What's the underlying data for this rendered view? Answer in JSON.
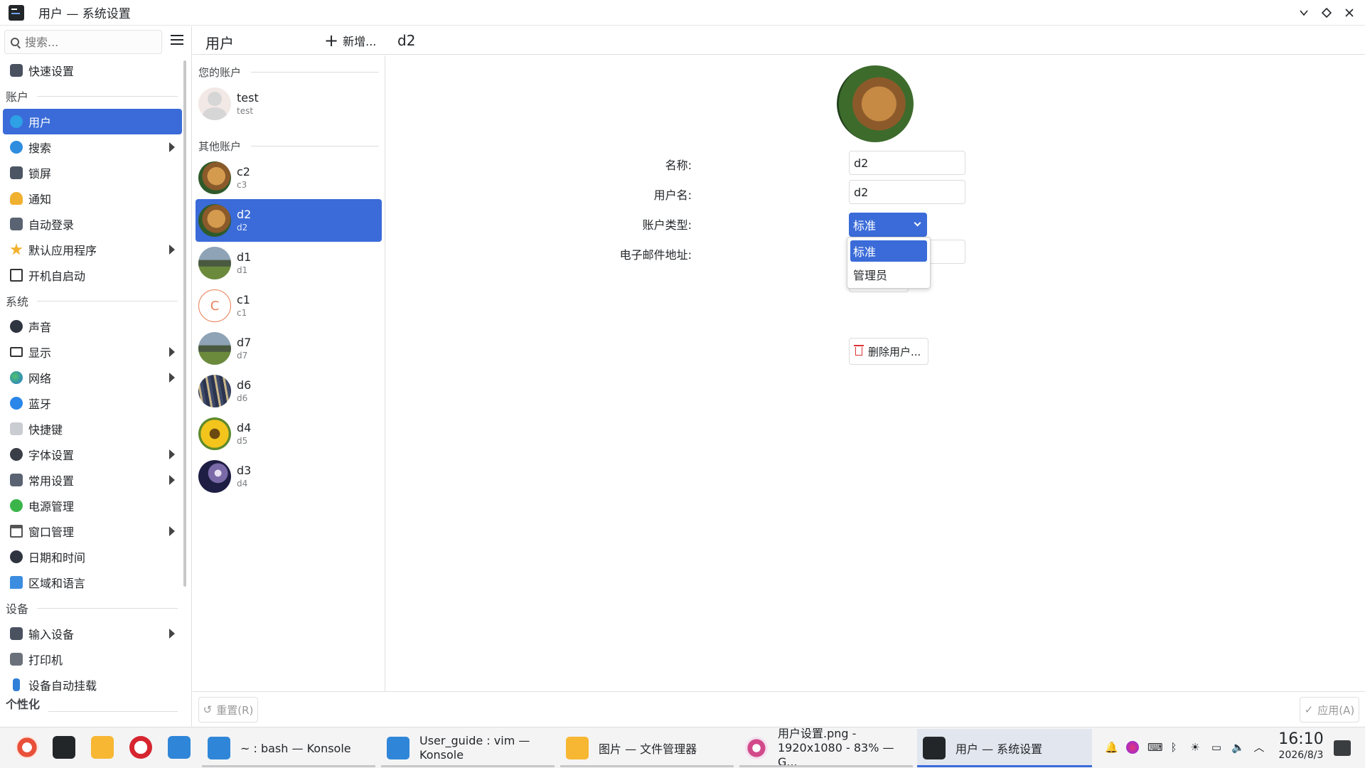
{
  "window": {
    "title": "用户 — 系统设置"
  },
  "search": {
    "placeholder": "搜索..."
  },
  "sidebar": {
    "quick_settings": "快速设置",
    "sections": {
      "accounts": "账户",
      "system": "系统",
      "devices": "设备",
      "personalization": "个性化"
    },
    "items": {
      "users": "用户",
      "search": "搜索",
      "lockscreen": "锁屏",
      "notifications": "通知",
      "autologin": "自动登录",
      "default_apps": "默认应用程序",
      "autostart": "开机自启动",
      "sound": "声音",
      "display": "显示",
      "network": "网络",
      "bluetooth": "蓝牙",
      "shortcuts": "快捷键",
      "fonts": "字体设置",
      "common": "常用设置",
      "power": "电源管理",
      "window_mgmt": "窗口管理",
      "datetime": "日期和时间",
      "region": "区域和语言",
      "input_devices": "输入设备",
      "printers": "打印机",
      "automount": "设备自动挂载"
    }
  },
  "toolbar": {
    "title": "用户",
    "add_label": "新增...",
    "selected_user": "d2"
  },
  "users": {
    "your_account_header": "您的账户",
    "other_accounts_header": "其他账户",
    "current": {
      "name": "test",
      "login": "test"
    },
    "others": [
      {
        "name": "c2",
        "login": "c3"
      },
      {
        "name": "d2",
        "login": "d2"
      },
      {
        "name": "d1",
        "login": "d1"
      },
      {
        "name": "c1",
        "login": "c1",
        "initial": "C"
      },
      {
        "name": "d7",
        "login": "d7"
      },
      {
        "name": "d6",
        "login": "d6"
      },
      {
        "name": "d4",
        "login": "d5"
      },
      {
        "name": "d3",
        "login": "d4"
      }
    ]
  },
  "detail": {
    "name_label": "名称:",
    "name_value": "d2",
    "username_label": "用户名:",
    "username_value": "d2",
    "account_type_label": "账户类型:",
    "account_type_value": "标准",
    "account_type_options": [
      "标准",
      "管理员"
    ],
    "email_label": "电子邮件地址:",
    "delete_label": "删除用户..."
  },
  "bottom": {
    "reset_label": "重置(R)",
    "apply_label": "应用(A)"
  },
  "taskbar": {
    "tasks": [
      {
        "line1": "~ : bash — Konsole",
        "line2": ""
      },
      {
        "line1": "User_guide : vim —",
        "line2": "Konsole"
      },
      {
        "line1": "图片 — 文件管理器",
        "line2": ""
      },
      {
        "line1": "用户设置.png -",
        "line2": "1920x1080 - 83% — G..."
      },
      {
        "line1": "用户 — 系统设置",
        "line2": ""
      }
    ],
    "time": "16:10",
    "date": "2026/8/3"
  },
  "colors": {
    "accent": "#3a6bd8",
    "text": "#232629"
  }
}
